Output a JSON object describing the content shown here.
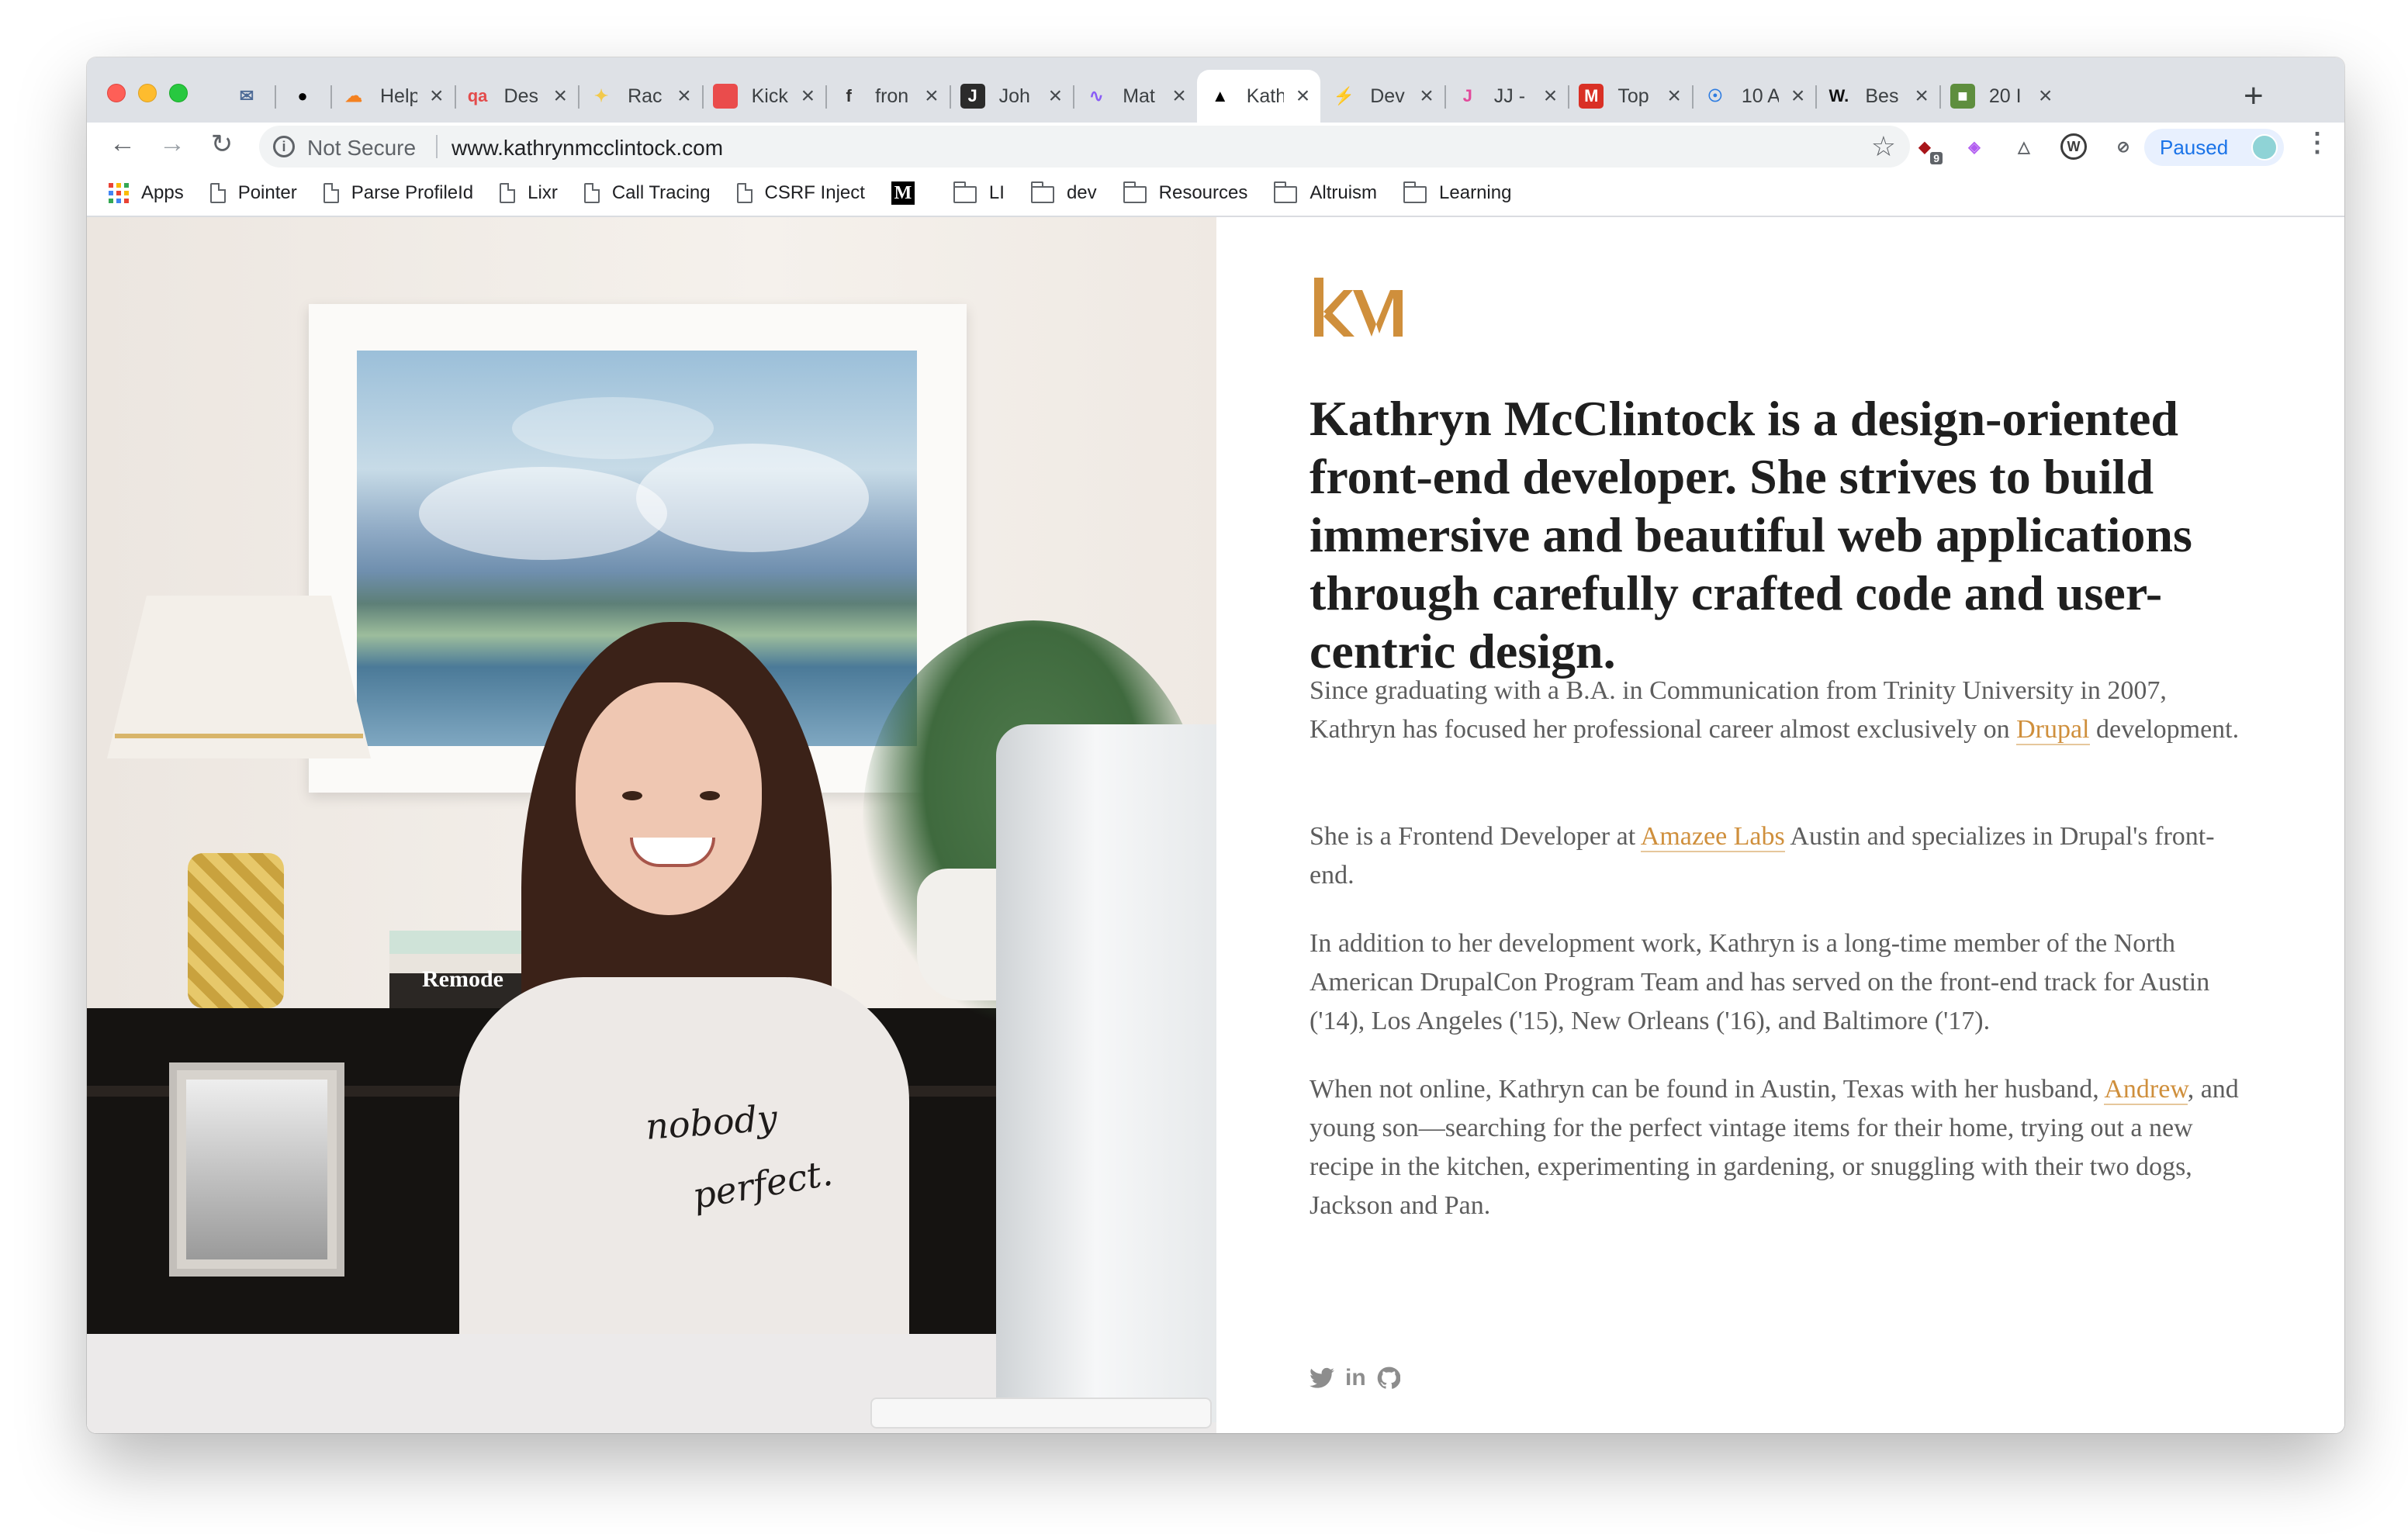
{
  "browser": {
    "tabs": [
      {
        "title": "",
        "favicon": "envelope-icon",
        "color": "#4d6a96"
      },
      {
        "title": "",
        "favicon": "github-icon",
        "color": "#000000"
      },
      {
        "title": "Help",
        "favicon": "cloudflare-icon",
        "color": "#f48120"
      },
      {
        "title": "Des",
        "favicon": "qa-icon",
        "color": "#e34b4b"
      },
      {
        "title": "Rac",
        "favicon": "sparkle-icon",
        "color": "#f2c94c"
      },
      {
        "title": "Kick",
        "favicon": "red-square-icon",
        "color": "#ea4c4c"
      },
      {
        "title": "fron",
        "favicon": "f-icon",
        "color": "#333333"
      },
      {
        "title": "Joh",
        "favicon": "j-icon",
        "color": "#2b2b2b"
      },
      {
        "title": "Mat",
        "favicon": "wave-icon",
        "color": "#8a5cf6"
      },
      {
        "title": "Kath",
        "favicon": "triangle-icon",
        "color": "#000000",
        "active": true
      },
      {
        "title": "Dev",
        "favicon": "bolt-icon",
        "color": "#111111"
      },
      {
        "title": "JJ -",
        "favicon": "jj-icon",
        "color": "#e24a9b"
      },
      {
        "title": "Top",
        "favicon": "m-red-icon",
        "color": "#d93025"
      },
      {
        "title": "10 A",
        "favicon": "cd-icon",
        "color": "#2f7de1"
      },
      {
        "title": "Bes",
        "favicon": "w-icon",
        "color": "#111111"
      },
      {
        "title": "20 I",
        "favicon": "shopify-icon",
        "color": "#5e8e3e"
      }
    ],
    "omnibox": {
      "security_label": "Not Secure",
      "url": "www.kathrynmcclintock.com"
    },
    "profile": {
      "label": "Paused"
    },
    "extensions": [
      {
        "icon": "ublock-icon",
        "badge": "9",
        "color": "#a8151a"
      },
      {
        "icon": "pen-icon",
        "color": "#b15cf0"
      },
      {
        "icon": "triangle-outline-icon",
        "color": "#5f6368"
      },
      {
        "icon": "wordpress-icon",
        "color": "#3c3c3c"
      },
      {
        "icon": "blocked-icon",
        "color": "#5f6368"
      },
      {
        "icon": "info-icon",
        "color": "#5f6368"
      }
    ],
    "bookmarks": [
      {
        "label": "Apps",
        "icon": "apps-icon"
      },
      {
        "label": "Pointer",
        "icon": "page-icon"
      },
      {
        "label": "Parse ProfileId",
        "icon": "page-icon"
      },
      {
        "label": "Lixr",
        "icon": "page-icon"
      },
      {
        "label": "Call Tracing",
        "icon": "page-icon"
      },
      {
        "label": "CSRF Inject",
        "icon": "page-icon"
      },
      {
        "label": "",
        "icon": "medium-icon"
      },
      {
        "label": "LI",
        "icon": "folder-icon"
      },
      {
        "label": "dev",
        "icon": "folder-icon"
      },
      {
        "label": "Resources",
        "icon": "folder-icon"
      },
      {
        "label": "Altruism",
        "icon": "folder-icon"
      },
      {
        "label": "Learning",
        "icon": "folder-icon"
      }
    ]
  },
  "page": {
    "logo_text": "kM",
    "accent_color": "#cf8f3c",
    "headline": "Kathryn McClintock is a design-oriented front-end developer. She strives to build immersive and beautiful web applications through carefully crafted code and user-centric design.",
    "p1": {
      "before": "Since graduating with a B.A. in Communication from Trinity University in 2007, Kathryn has focused her professional career almost exclusively on ",
      "link": "Drupal",
      "after": " development."
    },
    "p2": {
      "before": "She is a Frontend Developer at ",
      "link": "Amazee Labs",
      "after": " Austin and specializes in Drupal's front-end."
    },
    "p3": "In addition to her development work, Kathryn is a long-time member of the North American DrupalCon Program Team and has served on the front-end track for Austin ('14), Los Angeles ('15), New Orleans ('16), and Baltimore ('17).",
    "p4": {
      "before": "When not online, Kathryn can be found in Austin, Texas with her husband, ",
      "link": "Andrew",
      "after": ", and young son—searching for the perfect vintage items for their home, trying out a new recipe in the kitchen, experimenting in gardening, or snuggling with their two dogs, Jackson and Pan."
    },
    "photo": {
      "book_label": "Remode",
      "shirt_line1": "nobody",
      "shirt_line2": "perfect."
    },
    "social": [
      {
        "icon": "twitter-icon"
      },
      {
        "icon": "linkedin-icon",
        "label": "in"
      },
      {
        "icon": "github-icon"
      }
    ]
  }
}
